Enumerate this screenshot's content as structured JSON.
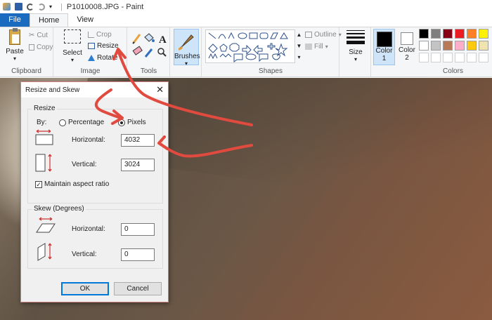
{
  "window": {
    "title": "P1010008.JPG - Paint"
  },
  "tabs": {
    "file": "File",
    "home": "Home",
    "view": "View"
  },
  "clipboard": {
    "paste": "Paste",
    "cut": "Cut",
    "copy": "Copy",
    "label": "Clipboard"
  },
  "image": {
    "select": "Select",
    "crop": "Crop",
    "resize": "Resize",
    "rotate": "Rotate",
    "label": "Image"
  },
  "tools": {
    "label": "Tools"
  },
  "brushes": {
    "label": "Brushes"
  },
  "shapes": {
    "outline": "Outline",
    "fill": "Fill",
    "label": "Shapes"
  },
  "size": {
    "label": "Size"
  },
  "colors": {
    "color1_label": "Color",
    "color1_num": "1",
    "color2_label": "Color",
    "color2_num": "2",
    "label": "Colors",
    "palette_row1": [
      "#000000",
      "#7f7f7f",
      "#880015",
      "#ed1c24",
      "#ff7f27",
      "#fff200"
    ],
    "palette_row2": [
      "#ffffff",
      "#c3c3c3",
      "#b97a57",
      "#ffaec9",
      "#ffc90e",
      "#efe4b0"
    ],
    "palette_row3": [
      "#ffffff",
      "#ffffff",
      "#ffffff",
      "#ffffff",
      "#ffffff",
      "#ffffff"
    ]
  },
  "dialog": {
    "title": "Resize and Skew",
    "resize_legend": "Resize",
    "by_label": "By:",
    "percentage_label": "Percentage",
    "pixels_label": "Pixels",
    "horizontal_label": "Horizontal:",
    "horizontal_value": "4032",
    "vertical_label": "Vertical:",
    "vertical_value": "3024",
    "maintain_label": "Maintain aspect ratio",
    "skew_legend": "Skew (Degrees)",
    "skew_horizontal_label": "Horizontal:",
    "skew_horizontal_value": "0",
    "skew_vertical_label": "Vertical:",
    "skew_vertical_value": "0",
    "ok": "OK",
    "cancel": "Cancel"
  },
  "annotation_color": "#e04a3f"
}
